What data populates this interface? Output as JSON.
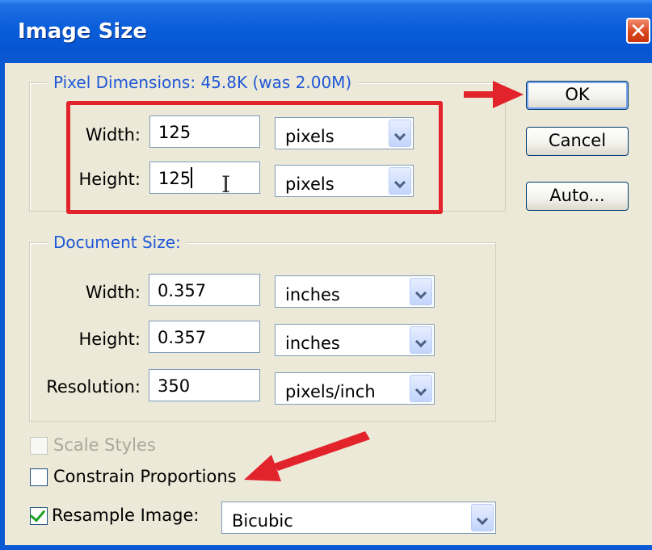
{
  "window": {
    "title": "Image Size"
  },
  "pixel_dimensions": {
    "legend": "Pixel Dimensions:  45.8K (was 2.00M)",
    "width_label": "Width:",
    "width_value": "125",
    "width_unit": "pixels",
    "height_label": "Height:",
    "height_value": "125",
    "height_unit": "pixels"
  },
  "document_size": {
    "legend": "Document Size:",
    "width_label": "Width:",
    "width_value": "0.357",
    "width_unit": "inches",
    "height_label": "Height:",
    "height_value": "0.357",
    "height_unit": "inches",
    "resolution_label": "Resolution:",
    "resolution_value": "350",
    "resolution_unit": "pixels/inch"
  },
  "buttons": {
    "ok": "OK",
    "cancel": "Cancel",
    "auto": "Auto..."
  },
  "options": {
    "scale_styles": "Scale Styles",
    "constrain_proportions": "Constrain Proportions",
    "resample_image": "Resample Image:",
    "resample_method": "Bicubic",
    "scale_styles_checked": false,
    "constrain_checked": false,
    "resample_checked": true
  },
  "annotations": {
    "color": "#e2232b"
  },
  "icons": {
    "close": "close-icon",
    "dropdown": "chevron-down-icon"
  }
}
